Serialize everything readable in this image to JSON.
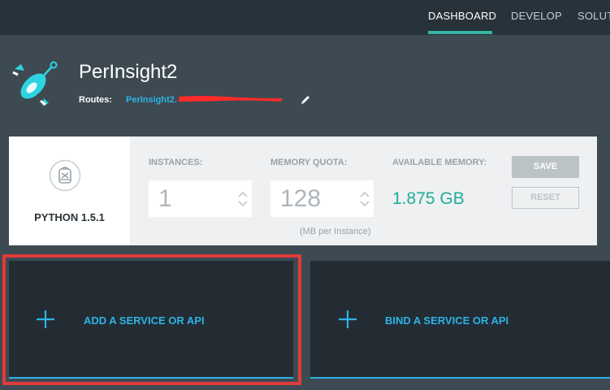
{
  "nav": {
    "tabs": [
      {
        "label": "DASHBOARD",
        "active": true
      },
      {
        "label": "DEVELOP",
        "active": false
      },
      {
        "label": "SOLUT",
        "active": false
      }
    ]
  },
  "app": {
    "name": "PerInsight2",
    "routes_label": "Routes:",
    "route_link": "PerInsight2."
  },
  "runtime": {
    "name": "PYTHON 1.5.1",
    "icon": "runtime-icon"
  },
  "config": {
    "instances_label": "INSTANCES:",
    "instances_value": "1",
    "memory_label": "MEMORY QUOTA:",
    "memory_value": "128",
    "memory_unit": "(MB per Instance)",
    "available_label": "AVAILABLE MEMORY:",
    "available_value": "1.875 GB",
    "save_label": "SAVE",
    "reset_label": "RESET"
  },
  "services": {
    "add_label": "ADD A SERVICE OR API",
    "bind_label": "BIND A SERVICE OR API"
  },
  "colors": {
    "accent_blue": "#2db3e6",
    "accent_teal": "#1fae98",
    "highlight_red": "#e23b3b",
    "redaction": "#ff2a2a"
  }
}
